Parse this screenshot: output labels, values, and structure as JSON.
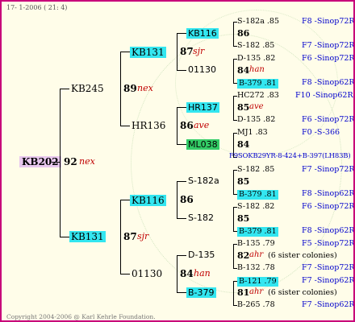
{
  "header": {
    "date": "17- 1-2006 ( 21: 4)"
  },
  "footer": {
    "copyright": "Copyright 2004-2006 @ Karl Kehrle Foundation."
  },
  "colors": {
    "border": "#c8007a",
    "cyan": "#33e6f0",
    "green": "#33cc66",
    "name": "#c00000",
    "ref": "#0000cc"
  },
  "root": {
    "id": "KB202",
    "num": "92",
    "name": "nex"
  },
  "gen1": {
    "top": {
      "id": "KB245",
      "num": "89",
      "name": "nex"
    },
    "bottom": {
      "id": "KB131",
      "num": "87",
      "name": "sjr"
    }
  },
  "gen2": [
    {
      "id": "KB131",
      "num": "87",
      "name": "sjr"
    },
    {
      "id": "HR136",
      "num": "86",
      "name": "ave"
    },
    {
      "id": "KB116",
      "num": "86",
      "name": ""
    },
    {
      "id": "01130",
      "num": "84",
      "name": "han"
    }
  ],
  "gen3": [
    {
      "id": "KB116"
    },
    {
      "id": "01130"
    },
    {
      "id": "HR137"
    },
    {
      "id": "ML038"
    },
    {
      "id": "S-182a"
    },
    {
      "id": "S-182"
    },
    {
      "id": "D-135"
    },
    {
      "id": "B-379"
    }
  ],
  "right": [
    {
      "top": "S-182a .85",
      "top_ref": "F8 -Sinop72R",
      "mid": "86",
      "mid_name": "",
      "bot": "S-182 .85",
      "bot_ref": "F7 -Sinop72R"
    },
    {
      "top": "D-135 .82",
      "top_ref": "F6 -Sinop72R",
      "mid": "84",
      "mid_name": "han",
      "bot": "B-379 .81",
      "bot_ref": "F8 -Sinop62R"
    },
    {
      "top": "HC272 .83",
      "top_ref": "F10 -Sinop62R",
      "mid": "85",
      "mid_name": "ave",
      "bot": "D-135 .82",
      "bot_ref": "F6 -Sinop72R"
    },
    {
      "top": "MJ1 .83",
      "top_ref": "F0 -S-366",
      "mid": "84",
      "mid_name": "",
      "bot": "F9SOKB29YR-8-424+B-397(LH83B)",
      "bot_ref": ""
    },
    {
      "top": "S-182 .85",
      "top_ref": "F7 -Sinop72R",
      "mid": "85",
      "mid_name": "",
      "bot": "B-379 .81",
      "bot_ref": "F8 -Sinop62R"
    },
    {
      "top": "S-182 .82",
      "top_ref": "F6 -Sinop72R",
      "mid": "85",
      "mid_name": "",
      "bot": "B-379 .81",
      "bot_ref": "F8 -Sinop62R"
    },
    {
      "top": "B-135 .79",
      "top_ref": "F5 -Sinop72R",
      "mid": "82",
      "mid_name": "ahr",
      "mid_note": "(6 sister colonies)",
      "bot": "B-132 .78",
      "bot_ref": "F7 -Sinop72R"
    },
    {
      "top": "B-121 .79",
      "top_ref": "F7 -Sinop62R",
      "mid": "81",
      "mid_name": "ahr",
      "mid_note": "(6 sister colonies)",
      "bot": "B-265 .78",
      "bot_ref": "F7 -Sinop62R"
    }
  ]
}
